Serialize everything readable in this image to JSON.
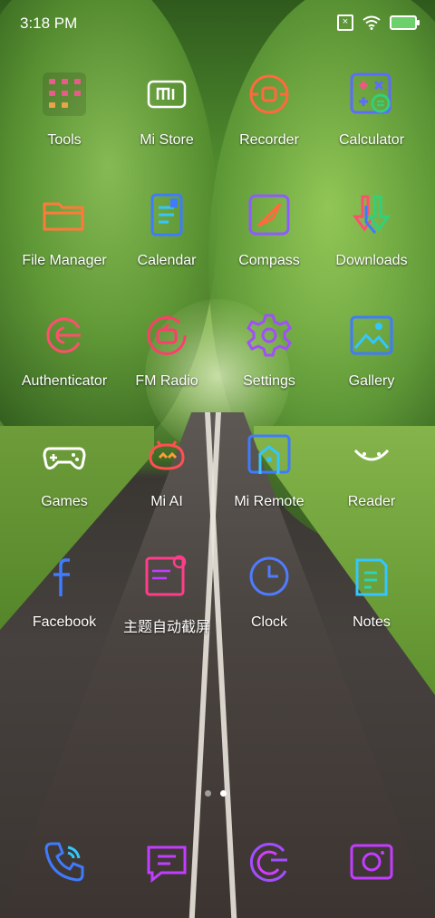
{
  "status_bar": {
    "time": "3:18 PM"
  },
  "apps": [
    {
      "label": "Tools"
    },
    {
      "label": "Mi Store"
    },
    {
      "label": "Recorder"
    },
    {
      "label": "Calculator"
    },
    {
      "label": "File Manager"
    },
    {
      "label": "Calendar"
    },
    {
      "label": "Compass"
    },
    {
      "label": "Downloads"
    },
    {
      "label": "Authenticator"
    },
    {
      "label": "FM Radio"
    },
    {
      "label": "Settings"
    },
    {
      "label": "Gallery"
    },
    {
      "label": "Games"
    },
    {
      "label": "Mi AI"
    },
    {
      "label": "Mi Remote"
    },
    {
      "label": "Reader"
    },
    {
      "label": "Facebook"
    },
    {
      "label": "主题自动截屏"
    },
    {
      "label": "Clock"
    },
    {
      "label": "Notes"
    }
  ],
  "page_indicator": {
    "pages": 2,
    "current": 2
  }
}
